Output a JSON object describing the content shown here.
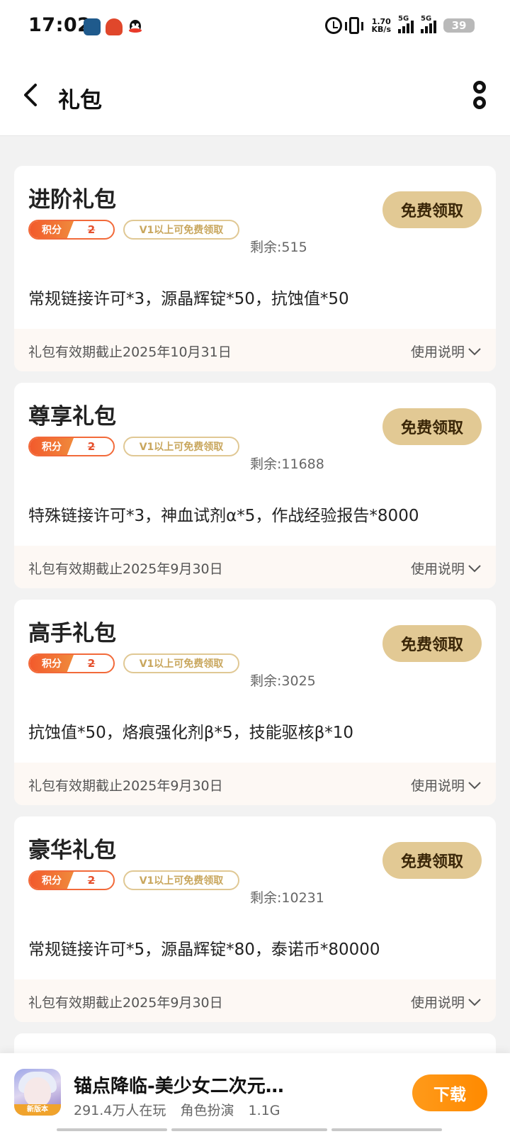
{
  "status_bar": {
    "time": "17:02",
    "net_speed_value": "1.70",
    "net_speed_unit": "KB/s",
    "sim1": "5G",
    "sim2": "5G",
    "battery": "39",
    "icons": [
      "game-app-icon",
      "red-app-icon",
      "qq-icon",
      "alarm-icon",
      "vibrate-icon"
    ]
  },
  "header": {
    "title": "礼包",
    "back_icon": "back-arrow-icon",
    "more_icon": "more-icon"
  },
  "gifts": [
    {
      "title": "进阶礼包",
      "points_label": "积分",
      "points_value": "2",
      "vip_label": "V1以上可免费领取",
      "remain": "剩余:515",
      "claim_label": "免费领取",
      "content": "常规链接许可*3，源晶辉锭*50，抗蚀值*50",
      "validity": "礼包有效期截止2025年10月31日",
      "usage_label": "使用说明"
    },
    {
      "title": "尊享礼包",
      "points_label": "积分",
      "points_value": "2",
      "vip_label": "V1以上可免费领取",
      "remain": "剩余:11688",
      "claim_label": "免费领取",
      "content": "特殊链接许可*3，神血试剂α*5，作战经验报告*8000",
      "validity": "礼包有效期截止2025年9月30日",
      "usage_label": "使用说明"
    },
    {
      "title": "高手礼包",
      "points_label": "积分",
      "points_value": "2",
      "vip_label": "V1以上可免费领取",
      "remain": "剩余:3025",
      "claim_label": "免费领取",
      "content": "抗蚀值*50，烙痕强化剂β*5，技能驱核β*10",
      "validity": "礼包有效期截止2025年9月30日",
      "usage_label": "使用说明"
    },
    {
      "title": "豪华礼包",
      "points_label": "积分",
      "points_value": "2",
      "vip_label": "V1以上可免费领取",
      "remain": "剩余:10231",
      "claim_label": "免费领取",
      "content": "常规链接许可*5，源晶辉锭*80，泰诺币*80000",
      "validity": "礼包有效期截止2025年9月30日",
      "usage_label": "使用说明"
    }
  ],
  "banner": {
    "app_name": "锚点降临-美少女二次元…",
    "players": "291.4万人在玩",
    "category": "角色扮演",
    "size": "1.1G",
    "icon_badge": "新版本",
    "download_label": "下载"
  },
  "colors": {
    "accent_gold": "#e2c994",
    "points_orange": "#f25a2c",
    "download_orange": "#ff9a1a"
  }
}
